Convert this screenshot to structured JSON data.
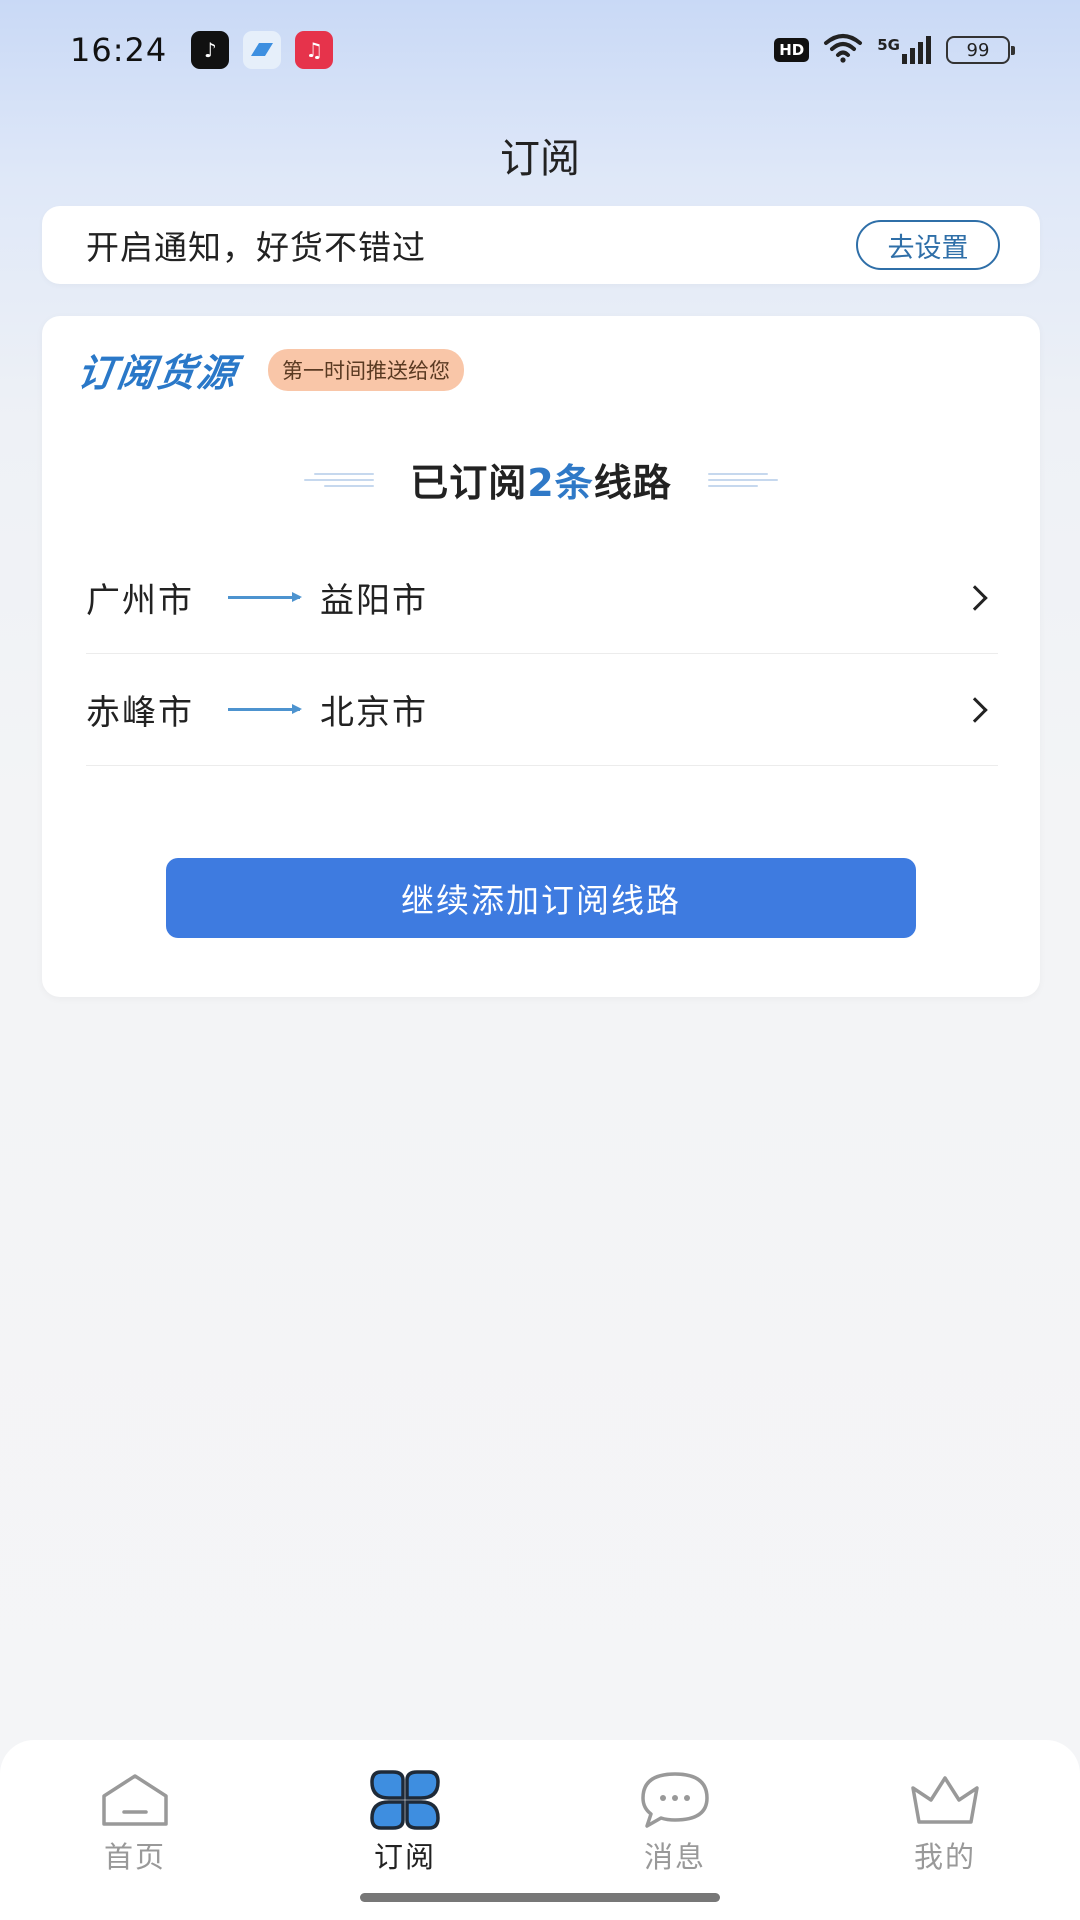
{
  "status_bar": {
    "time": "16:24",
    "hd": "HD",
    "network": "5G",
    "battery": "99",
    "apps": [
      "tiktok-icon",
      "blue-app-icon",
      "music-icon"
    ]
  },
  "header": {
    "title": "订阅"
  },
  "notify": {
    "text": "开启通知，好货不错过",
    "button_label": "去设置"
  },
  "subscription": {
    "brand_title": "订阅货源",
    "brand_tag": "第一时间推送给您",
    "heading_prefix": "已订阅",
    "heading_count": "2条",
    "heading_suffix": "线路",
    "routes": [
      {
        "from": "广州市",
        "to": "益阳市"
      },
      {
        "from": "赤峰市",
        "to": "北京市"
      }
    ],
    "add_button_label": "继续添加订阅线路"
  },
  "tabs": [
    {
      "label": "首页",
      "icon": "home-icon",
      "active": false
    },
    {
      "label": "订阅",
      "icon": "subscribe-icon",
      "active": true
    },
    {
      "label": "消息",
      "icon": "message-icon",
      "active": false
    },
    {
      "label": "我的",
      "icon": "crown-icon",
      "active": false
    }
  ],
  "colors": {
    "accent": "#3e7be0",
    "brand_blue": "#2a78c8",
    "tag_bg": "#f9c6a8",
    "link_blue": "#2f6fa8"
  }
}
